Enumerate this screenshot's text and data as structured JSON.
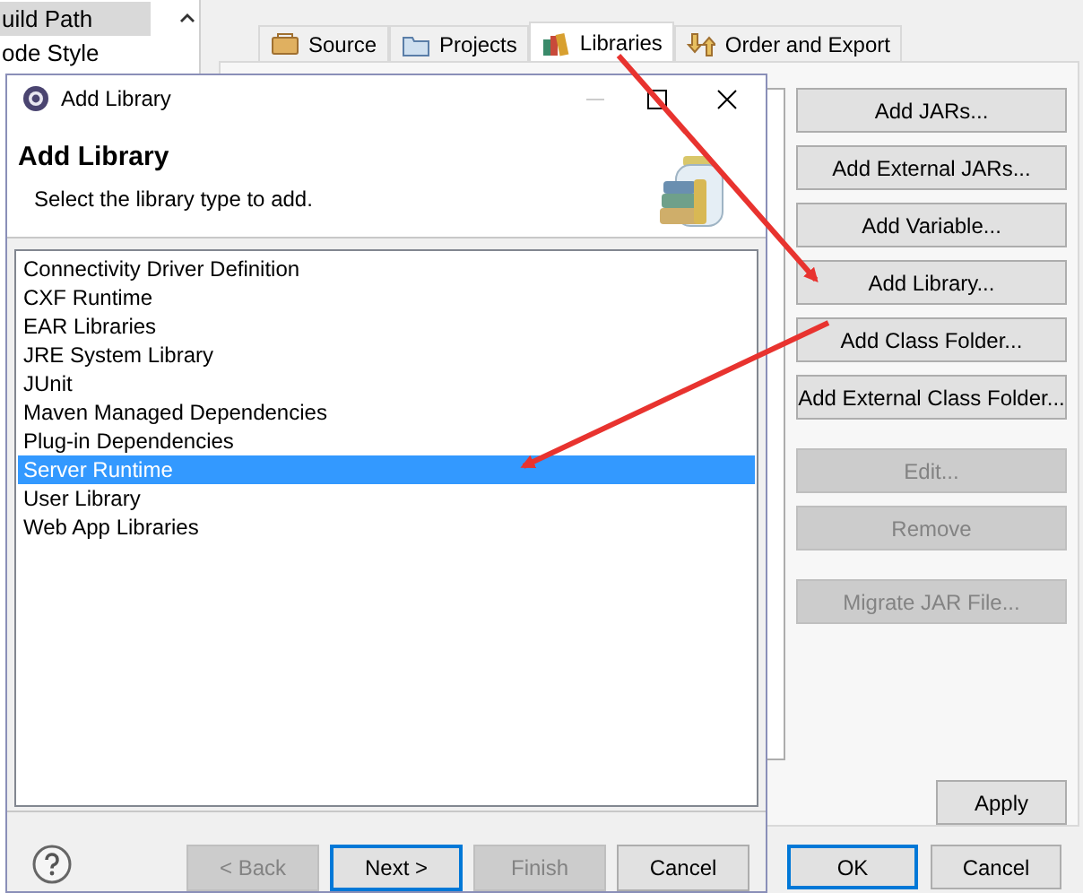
{
  "tree": {
    "items": [
      {
        "label": "uild Path",
        "selected": true
      },
      {
        "label": "ode Style",
        "selected": false
      }
    ]
  },
  "tabs": [
    {
      "label": "Source",
      "selected": false
    },
    {
      "label": "Projects",
      "selected": false
    },
    {
      "label": "Libraries",
      "selected": true
    },
    {
      "label": "Order and Export",
      "selected": false
    }
  ],
  "side_buttons": [
    {
      "label": "Add JARs...",
      "disabled": false
    },
    {
      "label": "Add External JARs...",
      "disabled": false
    },
    {
      "label": "Add Variable...",
      "disabled": false
    },
    {
      "label": "Add Library...",
      "disabled": false
    },
    {
      "label": "Add Class Folder...",
      "disabled": false
    },
    {
      "label": "Add External Class Folder...",
      "disabled": false
    },
    {
      "label": "Edit...",
      "disabled": true
    },
    {
      "label": "Remove",
      "disabled": true
    },
    {
      "label": "Migrate JAR File...",
      "disabled": true
    }
  ],
  "apply_button": "Apply",
  "footer_buttons": [
    {
      "label": "OK",
      "default": true
    },
    {
      "label": "Cancel",
      "default": false
    }
  ],
  "dialog": {
    "title": "Add Library",
    "heading": "Add Library",
    "description": "Select the library type to add.",
    "items": [
      {
        "label": "Connectivity Driver Definition",
        "selected": false
      },
      {
        "label": "CXF Runtime",
        "selected": false
      },
      {
        "label": "EAR Libraries",
        "selected": false
      },
      {
        "label": "JRE System Library",
        "selected": false
      },
      {
        "label": "JUnit",
        "selected": false
      },
      {
        "label": "Maven Managed Dependencies",
        "selected": false
      },
      {
        "label": "Plug-in Dependencies",
        "selected": false
      },
      {
        "label": "Server Runtime",
        "selected": true
      },
      {
        "label": "User Library",
        "selected": false
      },
      {
        "label": "Web App Libraries",
        "selected": false
      }
    ],
    "buttons": [
      {
        "label": "< Back",
        "disabled": true,
        "default": false
      },
      {
        "label": "Next >",
        "disabled": false,
        "default": true
      },
      {
        "label": "Finish",
        "disabled": true,
        "default": false
      },
      {
        "label": "Cancel",
        "disabled": false,
        "default": false
      }
    ]
  }
}
